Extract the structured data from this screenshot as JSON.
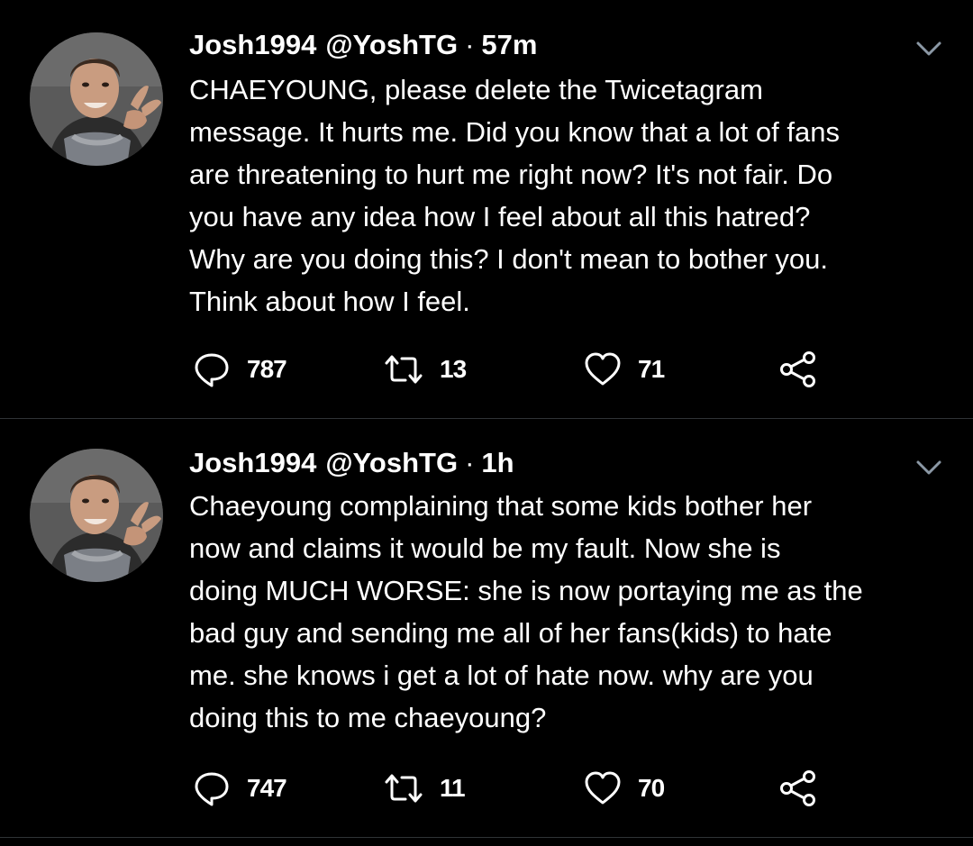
{
  "tweets": [
    {
      "display_name": "Josh1994",
      "handle": "@YoshTG",
      "separator": "·",
      "time": "57m",
      "text": "CHAEYOUNG, please delete the Twicetagram\nmessage. It hurts me. Did you know that a lot of fans\nare threatening to hurt me right now? It's not fair. Do\nyou have any idea how I feel about all this hatred?\nWhy are you doing this? I don't mean to bother you.\nThink about how I feel.",
      "replies": "787",
      "retweets": "13",
      "likes": "71"
    },
    {
      "display_name": "Josh1994",
      "handle": "@YoshTG",
      "separator": "·",
      "time": "1h",
      "text": "Chaeyoung complaining that some kids bother her\nnow and claims it would be my fault. Now she is\ndoing MUCH WORSE: she is now portaying me as the\nbad guy and sending me all of her fans(kids) to hate\nme. she knows i get a lot of hate now. why are you\ndoing this to me chaeyoung?",
      "replies": "747",
      "retweets": "11",
      "likes": "70"
    }
  ],
  "icons": {
    "reply": "speech-bubble-icon",
    "retweet": "retweet-arrows-icon",
    "like": "heart-icon",
    "share": "share-nodes-icon",
    "menu": "chevron-down-icon"
  },
  "colors": {
    "background": "#000000",
    "text": "#ffffff",
    "secondary": "#8b98a5",
    "divider": "#2f3336"
  }
}
